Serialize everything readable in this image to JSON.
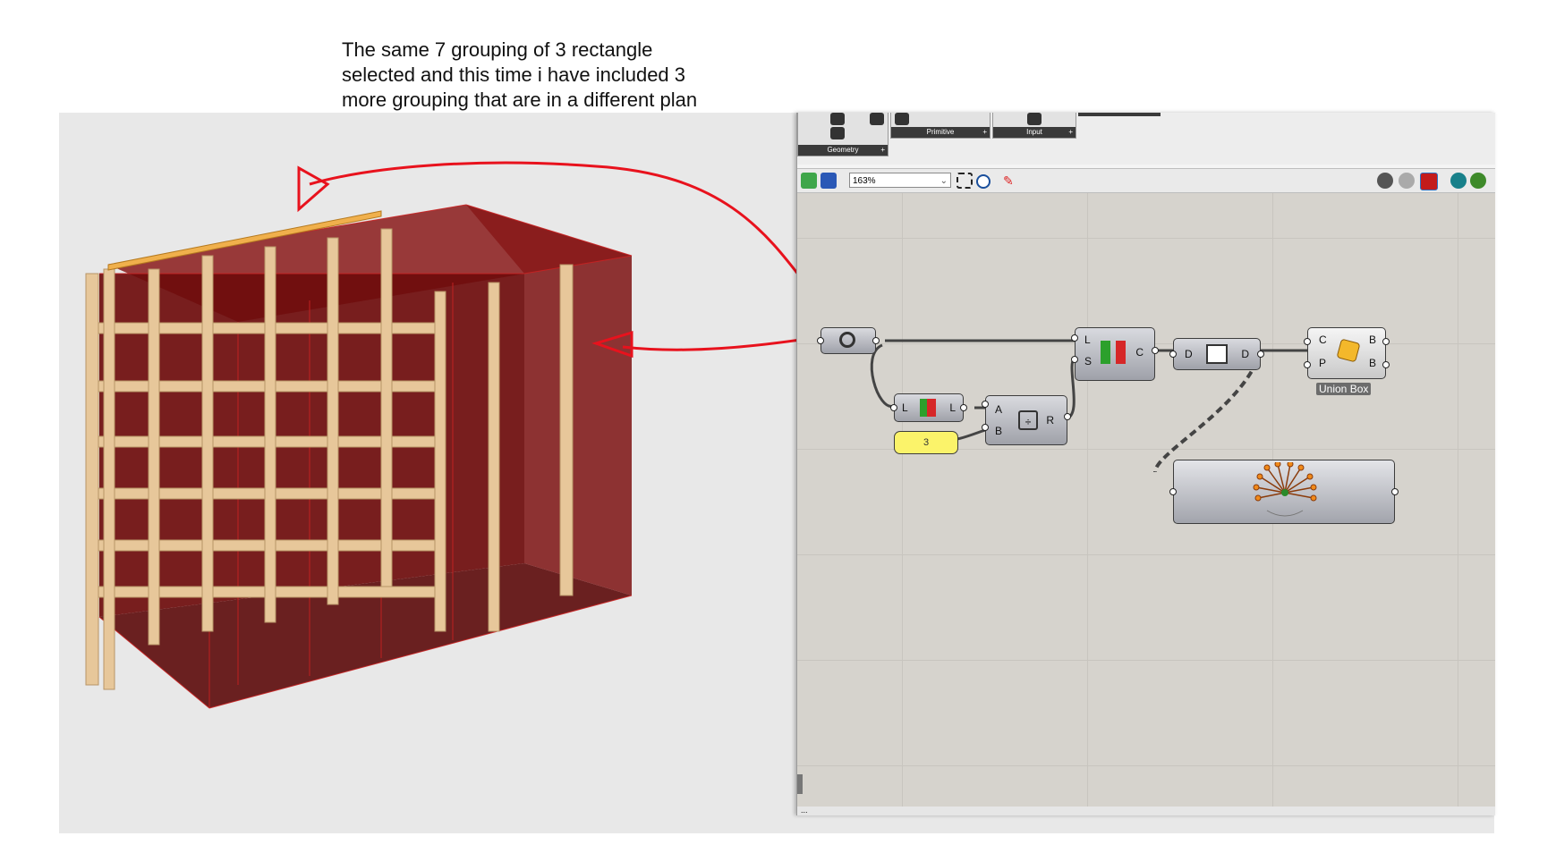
{
  "annotation": {
    "line1": "The same 7 grouping of 3 rectangle",
    "line2": "selected and this time i have included 3",
    "line3": "more grouping that are in a different plan"
  },
  "ribbon": {
    "geometry_label": "Geometry",
    "primitive_label": "Primitive",
    "input_label": "Input",
    "plus": "+"
  },
  "toolbar": {
    "zoom_value": "163%"
  },
  "components": {
    "list_length": {
      "in": "L",
      "out": "L"
    },
    "division": {
      "in_a": "A",
      "in_b": "B",
      "out": "R"
    },
    "partition": {
      "in_l": "L",
      "in_s": "S",
      "out": "C"
    },
    "flatten": {
      "in": "D",
      "out": "D"
    },
    "union_box": {
      "in_c": "C",
      "in_p": "P",
      "out_b1": "B",
      "out_b2": "B",
      "nickname": "Union Box"
    },
    "slider_value": "3"
  },
  "statusbar": {
    "text": "..."
  },
  "colors": {
    "annotation_stroke": "#e8121d",
    "box_fill": "#6e0c0c",
    "wood": "#e7c79a",
    "canvas": "#d6d3cd",
    "slider": "#fbf36a"
  }
}
